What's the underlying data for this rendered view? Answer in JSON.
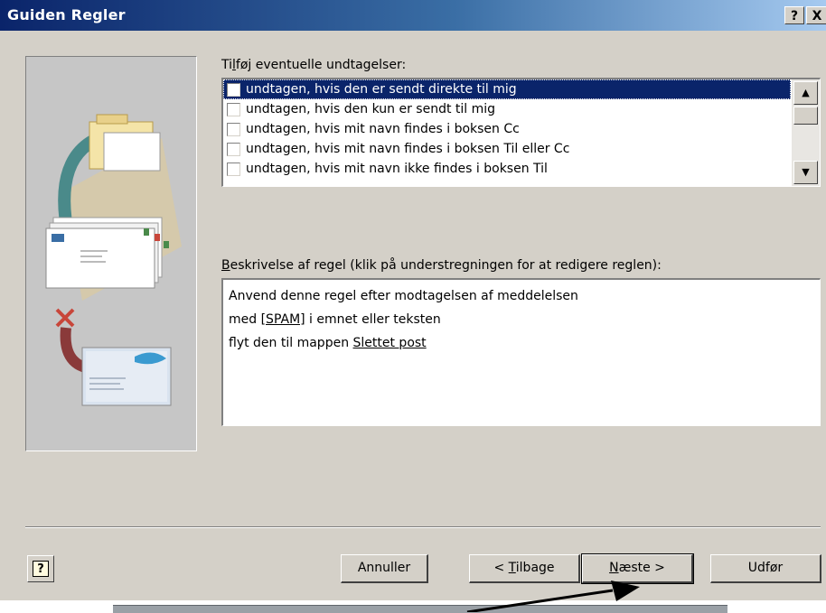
{
  "window": {
    "title": "Guiden Regler"
  },
  "titlebar_buttons": {
    "help": "?",
    "close": "X"
  },
  "exceptions": {
    "label_prefix": "Ti",
    "label_hotkey": "l",
    "label_rest": "føj eventuelle undtagelser:",
    "items": [
      {
        "label": "undtagen, hvis den er sendt direkte til mig",
        "checked": false,
        "selected": true
      },
      {
        "label": "undtagen, hvis den kun er sendt til mig",
        "checked": false,
        "selected": false
      },
      {
        "label": "undtagen, hvis mit navn findes i boksen Cc",
        "checked": false,
        "selected": false
      },
      {
        "label": "undtagen, hvis mit navn findes i boksen Til eller Cc",
        "checked": false,
        "selected": false
      },
      {
        "label": "undtagen, hvis mit navn ikke findes i boksen Til",
        "checked": false,
        "selected": false
      }
    ]
  },
  "description": {
    "label_hotkey": "B",
    "label_rest": "eskrivelse af regel (klik på understregningen for at redigere reglen):",
    "line1": "Anvend denne regel efter modtagelsen af meddelelsen",
    "line2_prefix": "med ",
    "line2_link": "[SPAM]",
    "line2_suffix": " i emnet eller teksten",
    "line3_prefix": "flyt den til mappen ",
    "line3_link": "Slettet post"
  },
  "buttons": {
    "cancel": "Annuller",
    "back_prefix": "< ",
    "back_hotkey": "T",
    "back_rest": "ilbage",
    "next_hotkey": "N",
    "next_rest": "æste >",
    "finish": "Udfør"
  },
  "colors": {
    "titlebar_start": "#0a246a",
    "titlebar_end": "#a6caf0",
    "dialog_bg": "#d4d0c8",
    "selection": "#0a246a"
  },
  "icons": [
    "help-icon",
    "close-icon",
    "scroll-up-icon",
    "scroll-down-icon",
    "context-help-icon",
    "pointer-arrow"
  ]
}
